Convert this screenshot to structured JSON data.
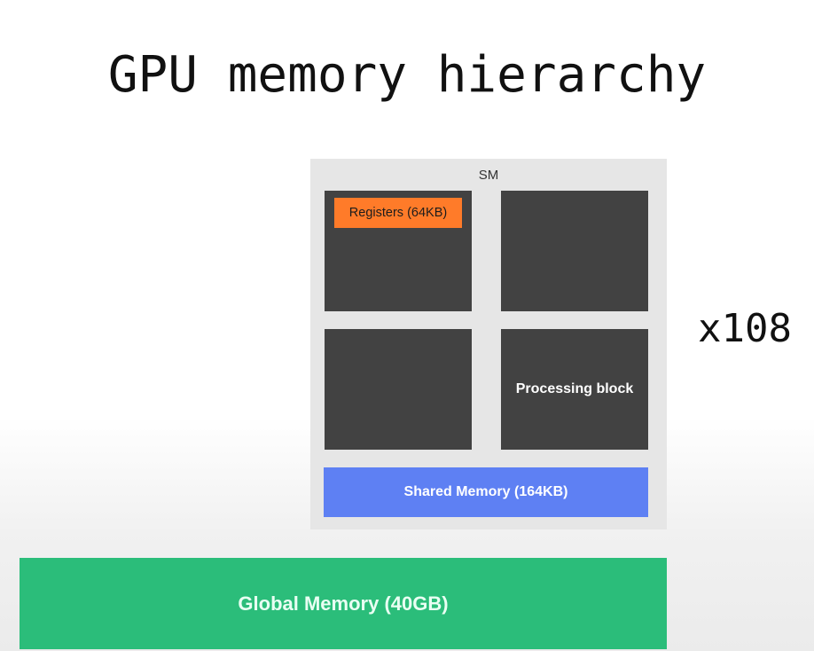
{
  "title": "GPU memory hierarchy",
  "sm": {
    "label": "SM",
    "registers_label": "Registers (64KB)",
    "processing_block_label": "Processing block",
    "shared_memory_label": "Shared Memory (164KB)"
  },
  "multiplier": "x108",
  "global_memory_label": "Global Memory (40GB)",
  "colors": {
    "sm_background": "#e6e6e6",
    "processing_block": "#424242",
    "registers": "#ff7b29",
    "shared_memory": "#5e80f3",
    "global_memory": "#2bbd7a"
  }
}
